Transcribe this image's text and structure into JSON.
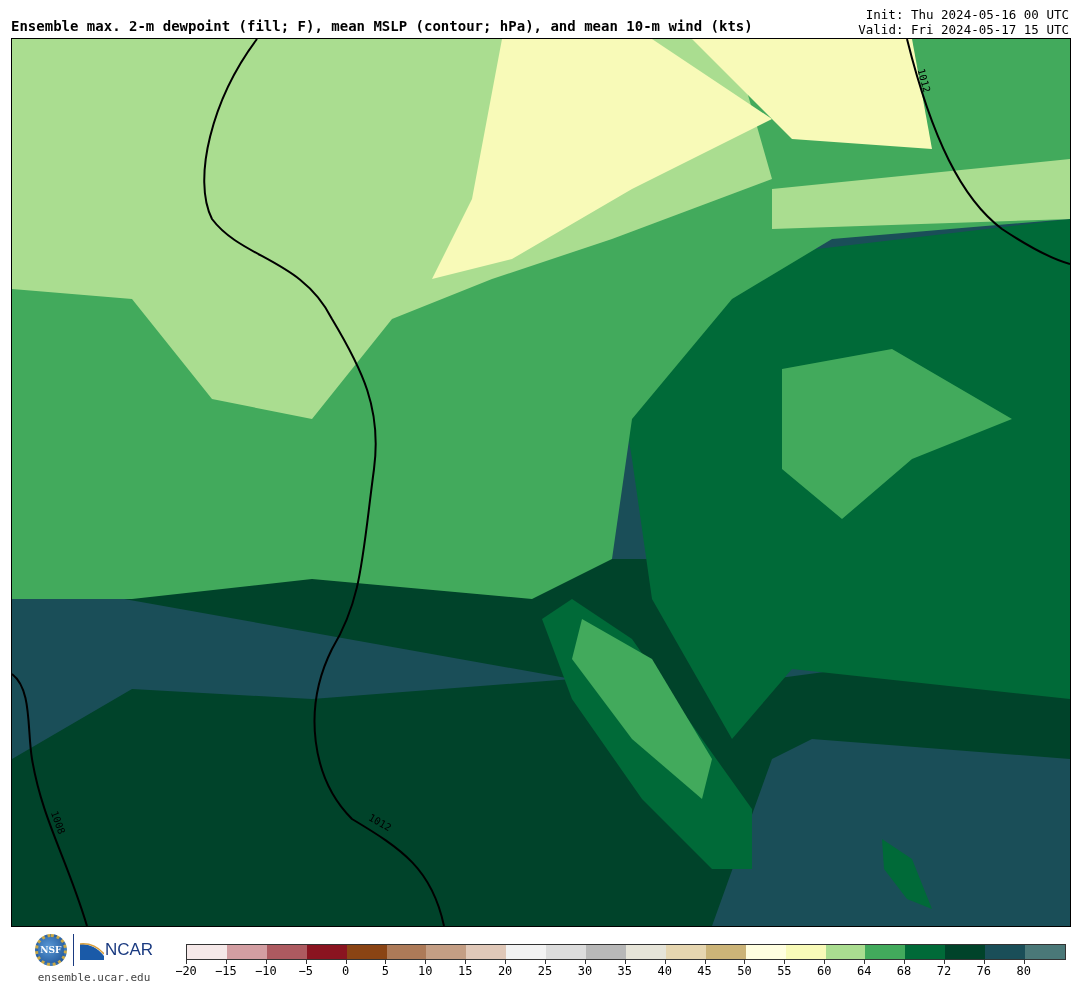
{
  "header": {
    "title": "Ensemble max. 2-m dewpoint (fill; F), mean MSLP (contour; hPa), and mean 10-m wind (kts)",
    "init": "Init: Thu 2024-05-16 00 UTC",
    "valid": "Valid: Fri 2024-05-17 15 UTC"
  },
  "map": {
    "isobar_labels": [
      "1012",
      "1008",
      "1012"
    ]
  },
  "footer": {
    "nsf_logo": "NSF",
    "ncar_logo": "NCAR",
    "site": "ensemble.ucar.edu"
  },
  "colorbar": {
    "segments": [
      {
        "color": "#f5e8e8"
      },
      {
        "color": "#d39ea2"
      },
      {
        "color": "#ad5a60"
      },
      {
        "color": "#8a1420"
      },
      {
        "color": "#8a4414"
      },
      {
        "color": "#ad7a58"
      },
      {
        "color": "#c49e84"
      },
      {
        "color": "#e0c8b8"
      },
      {
        "color": "#f2f2f2"
      },
      {
        "color": "#dcdcdc"
      },
      {
        "color": "#b8b8b8"
      },
      {
        "color": "#e6e4d8"
      },
      {
        "color": "#e6d6b0"
      },
      {
        "color": "#ccb478"
      },
      {
        "color": "#fffee0"
      },
      {
        "color": "#f8fab8"
      },
      {
        "color": "#aadd90"
      },
      {
        "color": "#42aa5c"
      },
      {
        "color": "#006a38"
      },
      {
        "color": "#00432a"
      },
      {
        "color": "#1a4e58"
      },
      {
        "color": "#4a7878"
      }
    ],
    "ticks": [
      "−20",
      "−15",
      "−10",
      "−5",
      "0",
      "5",
      "10",
      "15",
      "20",
      "25",
      "30",
      "35",
      "40",
      "45",
      "50",
      "55",
      "60",
      "64",
      "68",
      "72",
      "76",
      "80"
    ]
  }
}
